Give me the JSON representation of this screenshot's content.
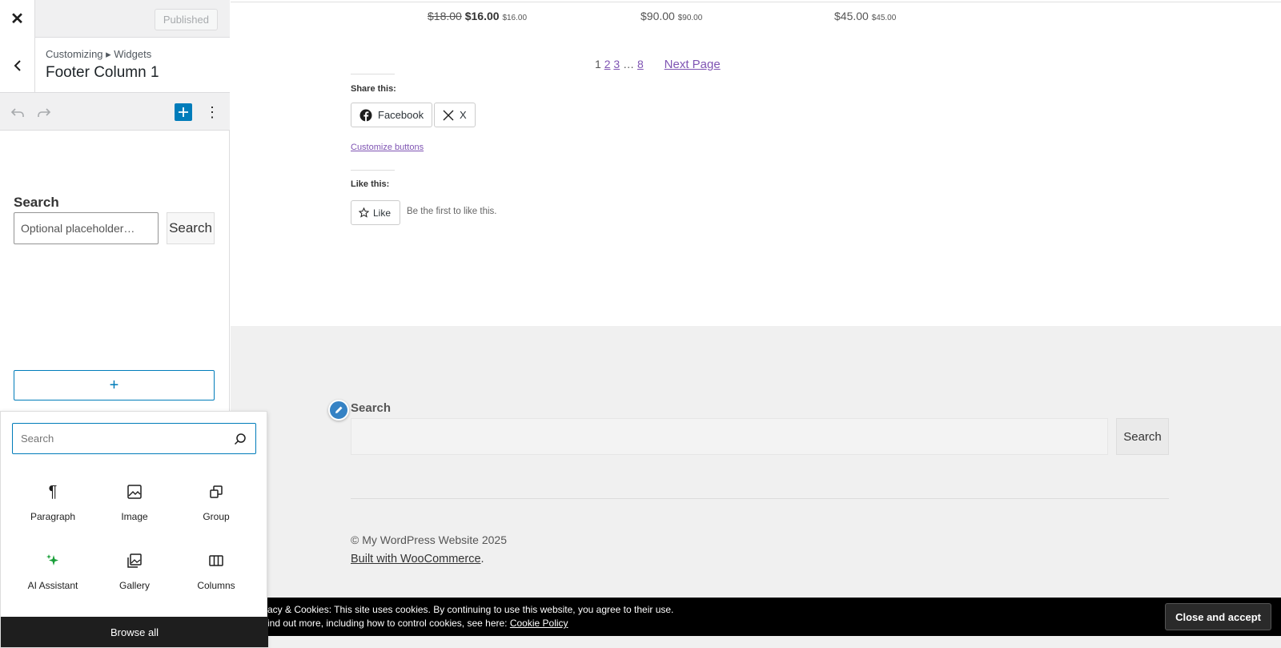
{
  "sidebar": {
    "close_icon": "close-icon",
    "published_label": "Published",
    "breadcrumb": "Customizing ▸ Widgets",
    "title": "Footer Column 1",
    "widget": {
      "label": "Search",
      "input_placeholder": "Optional placeholder…",
      "button_label": "Search"
    },
    "add_block_symbol": "+"
  },
  "inserter": {
    "search_placeholder": "Search",
    "blocks": [
      {
        "label": "Paragraph",
        "icon": "paragraph-icon"
      },
      {
        "label": "Image",
        "icon": "image-icon"
      },
      {
        "label": "Group",
        "icon": "group-icon"
      },
      {
        "label": "AI Assistant",
        "icon": "ai-assistant-icon"
      },
      {
        "label": "Gallery",
        "icon": "gallery-icon"
      },
      {
        "label": "Columns",
        "icon": "columns-icon"
      }
    ],
    "browse_all_label": "Browse all"
  },
  "preview": {
    "prices": [
      {
        "old": "$18.00",
        "new": "$16.00",
        "small": "$16.00"
      },
      {
        "new": "$90.00",
        "small": "$90.00"
      },
      {
        "new": "$45.00",
        "small": "$45.00"
      }
    ],
    "pagination": {
      "current": "1",
      "pages": [
        "2",
        "3"
      ],
      "ellipsis": "…",
      "last": "8",
      "next_label": "Next Page"
    },
    "share": {
      "heading": "Share this:",
      "facebook_label": "Facebook",
      "x_label": "X",
      "customize_label": "Customize buttons"
    },
    "like": {
      "heading": "Like this:",
      "button_label": "Like",
      "text": "Be the first to like this."
    },
    "footer": {
      "search_label": "Search",
      "search_button": "Search",
      "copyright": "© My WordPress Website 2025",
      "built_link": "Built with WooCommerce",
      "built_suffix": "."
    },
    "cookie": {
      "line1": "acy & Cookies: This site uses cookies. By continuing to use this website, you agree to their use.",
      "line2_prefix": "ind out more, including how to control cookies, see here: ",
      "policy_link": "Cookie Policy",
      "accept_label": "Close and accept"
    }
  },
  "colors": {
    "accent": "#007cba",
    "link": "#7f54b3",
    "footer_bg": "#f0f0f0",
    "ai_icon": "#1a9f3a"
  }
}
